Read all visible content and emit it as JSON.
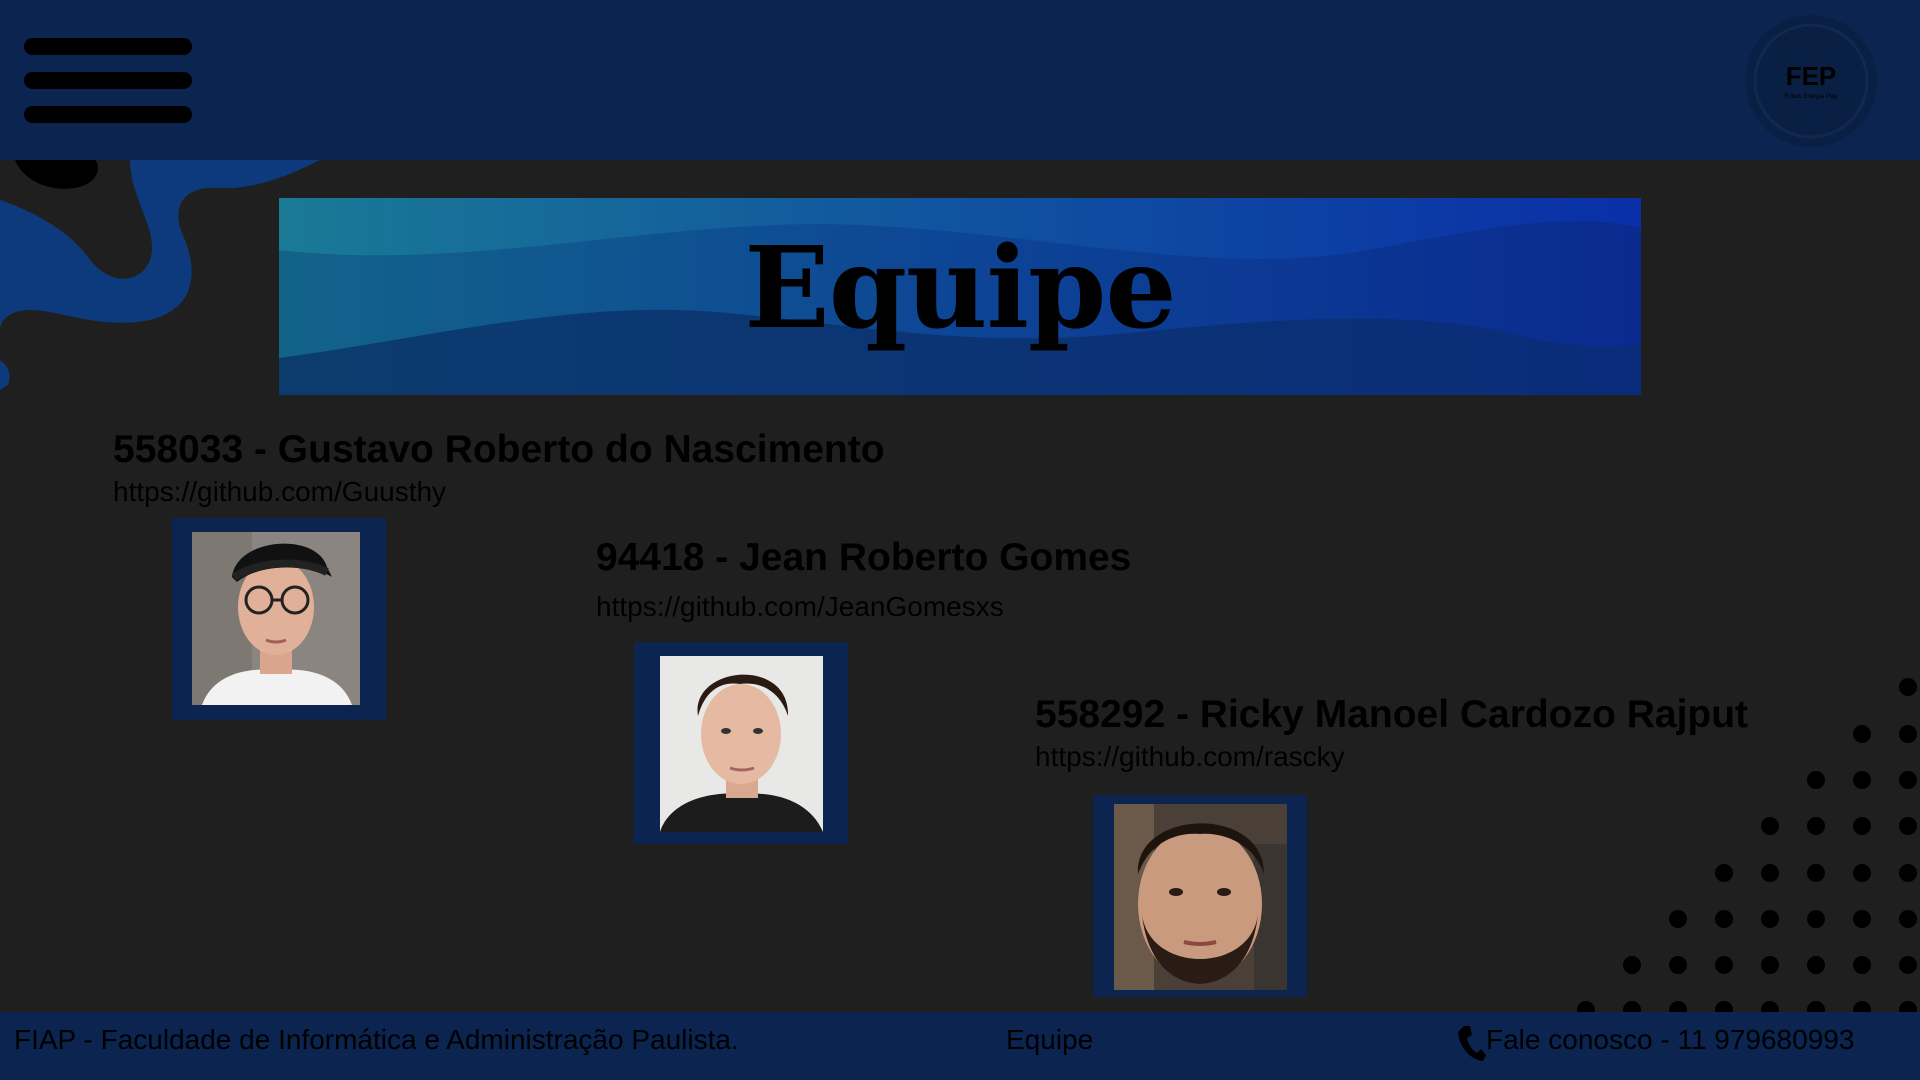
{
  "header": {
    "menu_icon": "hamburger-menu-icon",
    "logo_text": "FEP",
    "logo_subtext": "Futuro Energia Play"
  },
  "banner": {
    "title": "Equipe"
  },
  "members": [
    {
      "name": "558033 - Gustavo Roberto do Nascimento",
      "github": "https://github.com/Guusthy"
    },
    {
      "name": "94418 - Jean Roberto Gomes",
      "github": "https://github.com/JeanGomesxs"
    },
    {
      "name": "558292 - Ricky Manoel Cardozo Rajput",
      "github": "https://github.com/rascky"
    }
  ],
  "footer": {
    "institution": "FIAP - Faculdade de Informática e Administração Paulista.",
    "page_label": "Equipe",
    "contact_icon": "phone-icon",
    "contact": "Fale conosco - 11 979680993"
  },
  "colors": {
    "background": "#1f1f1f",
    "navy": "#0b2450",
    "banner_teal": "#1a7a96",
    "banner_blue": "#0a2fa8"
  }
}
